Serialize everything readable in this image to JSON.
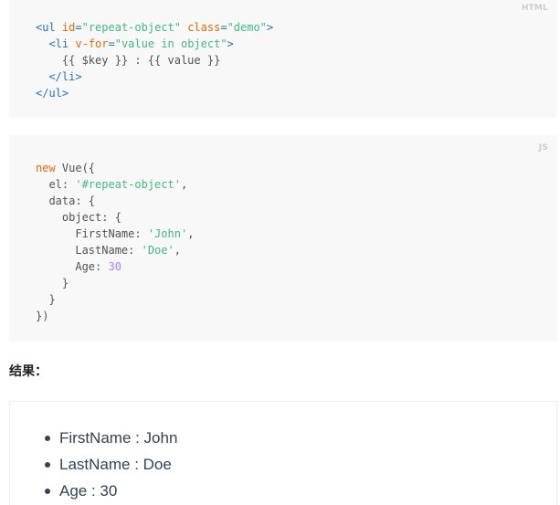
{
  "html_block": {
    "label": "HTML",
    "lines": [
      [
        {
          "t": "<ul ",
          "c": "tag"
        },
        {
          "t": "id",
          "c": "attr"
        },
        {
          "t": "=",
          "c": "tag"
        },
        {
          "t": "\"repeat-object\"",
          "c": "str"
        },
        {
          "t": " ",
          "c": "tag"
        },
        {
          "t": "class",
          "c": "attr"
        },
        {
          "t": "=",
          "c": "tag"
        },
        {
          "t": "\"demo\"",
          "c": "str"
        },
        {
          "t": ">",
          "c": "tag"
        }
      ],
      [
        {
          "t": "  <li ",
          "c": "tag"
        },
        {
          "t": "v-for",
          "c": "attr"
        },
        {
          "t": "=",
          "c": "tag"
        },
        {
          "t": "\"value in object\"",
          "c": "str"
        },
        {
          "t": ">",
          "c": "tag"
        }
      ],
      [
        {
          "t": "    {{ $key }} : {{ value }}",
          "c": "plain"
        }
      ],
      [
        {
          "t": "  </li>",
          "c": "tag"
        }
      ],
      [
        {
          "t": "</ul>",
          "c": "tag"
        }
      ]
    ]
  },
  "js_block": {
    "label": "JS",
    "lines": [
      [
        {
          "t": "new",
          "c": "kw"
        },
        {
          "t": " Vue({",
          "c": "plain"
        }
      ],
      [
        {
          "t": "  el: ",
          "c": "plain"
        },
        {
          "t": "'#repeat-object'",
          "c": "str"
        },
        {
          "t": ",",
          "c": "plain"
        }
      ],
      [
        {
          "t": "  data: {",
          "c": "plain"
        }
      ],
      [
        {
          "t": "    object: {",
          "c": "plain"
        }
      ],
      [
        {
          "t": "      FirstName: ",
          "c": "plain"
        },
        {
          "t": "'John'",
          "c": "str"
        },
        {
          "t": ",",
          "c": "plain"
        }
      ],
      [
        {
          "t": "      LastName: ",
          "c": "plain"
        },
        {
          "t": "'Doe'",
          "c": "str"
        },
        {
          "t": ",",
          "c": "plain"
        }
      ],
      [
        {
          "t": "      Age: ",
          "c": "plain"
        },
        {
          "t": "30",
          "c": "num"
        }
      ],
      [
        {
          "t": "    }",
          "c": "plain"
        }
      ],
      [
        {
          "t": "  }",
          "c": "plain"
        }
      ],
      [
        {
          "t": "})",
          "c": "plain"
        }
      ]
    ]
  },
  "result": {
    "heading": "结果：",
    "items": [
      "FirstName : John",
      "LastName : Doe",
      "Age : 30"
    ]
  },
  "colors": {
    "code_bg": "#f8f8f8",
    "tag": "#2973b7",
    "attr": "#e96900",
    "string": "#42b983",
    "keyword": "#e96900",
    "number": "#ae81ff",
    "plain": "#525252",
    "text": "#304455",
    "label": "#cccccc"
  }
}
